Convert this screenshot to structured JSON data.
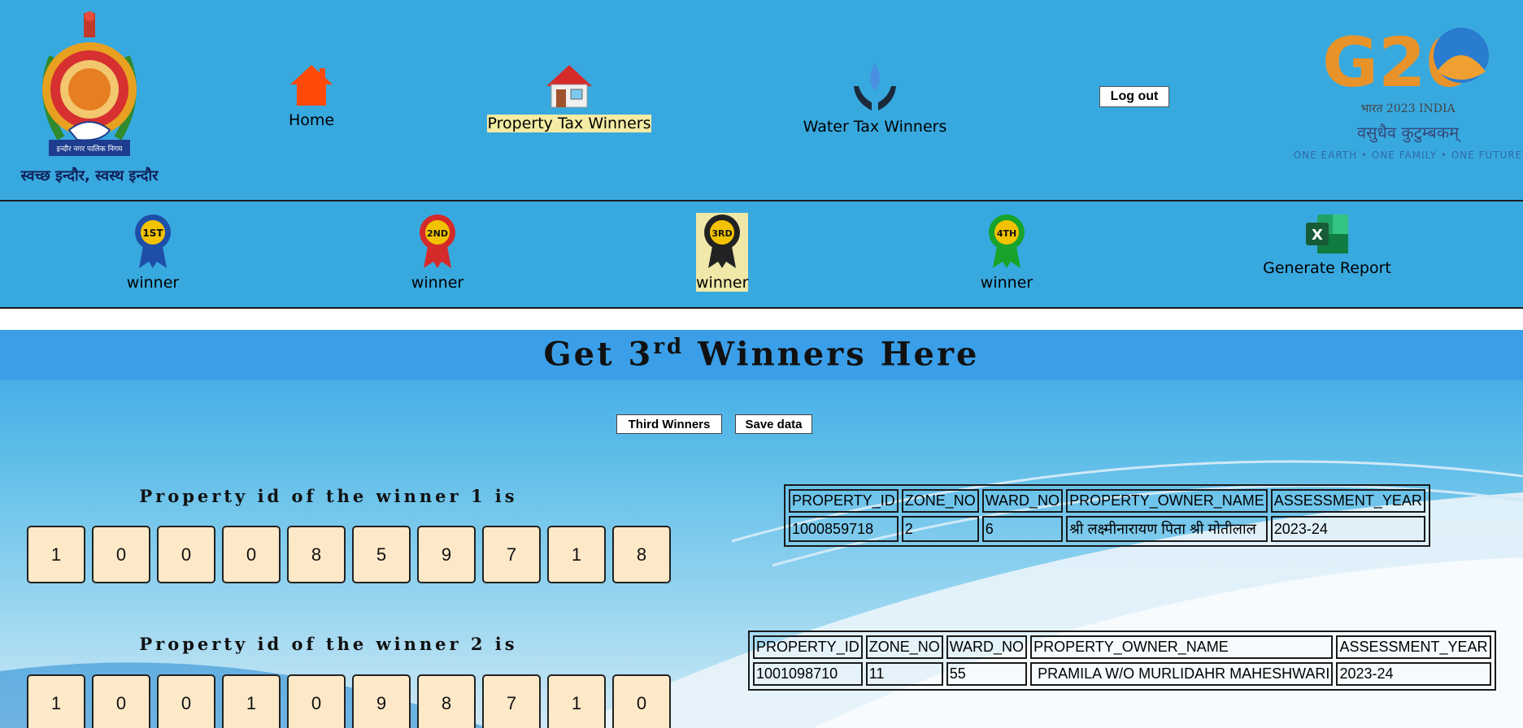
{
  "header": {
    "org_logo_text": "इन्दौर नगर पालिक निगम",
    "tagline": "स्वच्छ इन्दौर, स्वस्थ इन्दौर",
    "nav": [
      {
        "label": "Home",
        "icon": "home-icon"
      },
      {
        "label": "Property Tax Winners",
        "icon": "house-icon",
        "active": true
      },
      {
        "label": "Water Tax Winners",
        "icon": "water-drop-hands-icon"
      }
    ],
    "logout_label": "Log out",
    "g20": {
      "logo_text": "G20",
      "india_line": "भारत 2023 INDIA",
      "motto": "वसुधैव कुटुम्बकम्",
      "subtitle": "ONE EARTH • ONE FAMILY • ONE FUTURE"
    }
  },
  "winner_nav": {
    "items": [
      {
        "badge": "1ST",
        "label": "winner",
        "color": "#1e4fa8"
      },
      {
        "badge": "2ND",
        "label": "winner",
        "color": "#d42a2a"
      },
      {
        "badge": "3RD",
        "label": "winner",
        "color": "#222222",
        "active": true
      },
      {
        "badge": "4TH",
        "label": "winner",
        "color": "#18a32a"
      }
    ],
    "report_label": "Generate Report",
    "report_icon_letter": "X"
  },
  "main": {
    "title_prefix": "Get 3",
    "title_sup": "rd",
    "title_suffix": " Winners Here",
    "third_winners_btn": "Third Winners",
    "save_btn": "Save data",
    "columns": [
      "PROPERTY_ID",
      "ZONE_NO",
      "WARD_NO",
      "PROPERTY_OWNER_NAME",
      "ASSESSMENT_YEAR"
    ],
    "winners": [
      {
        "heading": "Property id of the winner 1 is",
        "digits": [
          "1",
          "0",
          "0",
          "0",
          "8",
          "5",
          "9",
          "7",
          "1",
          "8"
        ],
        "row": [
          "1000859718",
          "2",
          "6",
          "श्री लक्ष्मीनारायण पिता श्री मोतीलाल",
          "2023-24"
        ]
      },
      {
        "heading": "Property id of the winner 2 is",
        "digits": [
          "1",
          "0",
          "0",
          "1",
          "0",
          "9",
          "8",
          "7",
          "1",
          "0"
        ],
        "row": [
          "1001098710",
          "11",
          "55",
          " PRAMILA W/O MURLIDAHR MAHESHWARI",
          "2023-24"
        ]
      }
    ]
  }
}
